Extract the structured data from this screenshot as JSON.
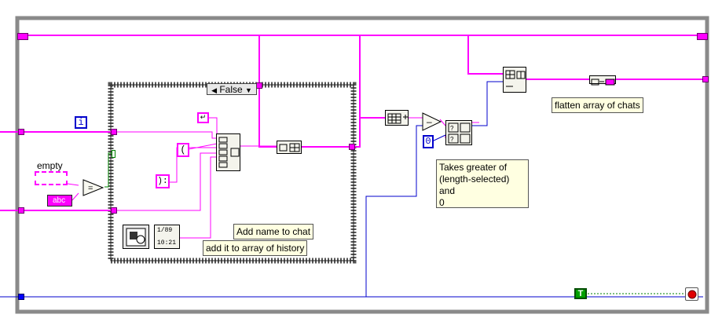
{
  "case_structure": {
    "selector_value": "False",
    "prev_arrow": "◀",
    "next_arrow": "▼"
  },
  "constants": {
    "empty_label": "empty",
    "empty_string": "",
    "loop_index": "i",
    "paren_open": "(",
    "paren_close": "):",
    "zero": "0",
    "true_const": "T",
    "string_const": "abc"
  },
  "comments": {
    "add_name": "Add name to chat",
    "add_history": "add it to array of history",
    "flatten": "flatten array of chats",
    "takes_greater": "Takes greater of\n(length-selected) and\n0"
  },
  "functions": {
    "date_time": "1/89",
    "time": "10:21"
  },
  "colors": {
    "string_wire": "#ff00ff",
    "numeric_wire": "#0000cc",
    "boolean_wire": "#006600",
    "structure_frame": "#7a7a7a",
    "comment_bg": "#ffffe1"
  }
}
